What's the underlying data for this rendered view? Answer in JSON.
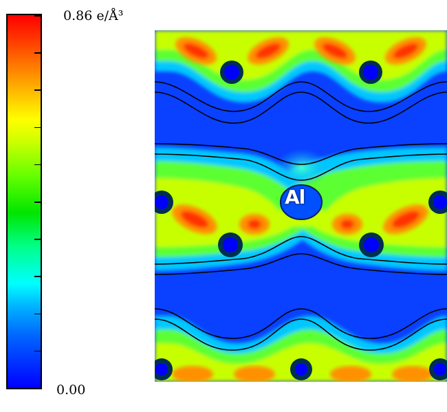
{
  "colorbar": {
    "max_label": "0.86 e/Å³",
    "min_label": "0.00",
    "tick_count": 10
  },
  "atom_label": "Al",
  "colors": {
    "low": "#0000ff",
    "mid": "#00e600",
    "high": "#ff0000"
  }
}
